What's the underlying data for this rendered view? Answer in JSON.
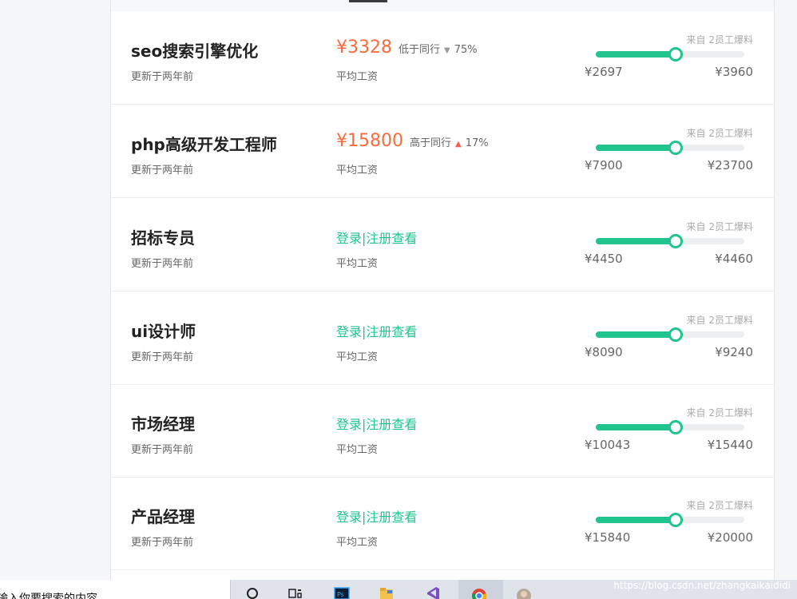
{
  "jobs": [
    {
      "title": "seo搜索引擎优化",
      "updated": "更新于两年前",
      "salary": "¥3328",
      "compare": "低于同行",
      "direction": "down",
      "percent": "75%",
      "login_text": "",
      "salary_label": "平均工资",
      "source": "来自 2员工爆料",
      "range_min": "¥2697",
      "range_max": "¥3960",
      "bar_fraction": 0.53
    },
    {
      "title": "php高级开发工程师",
      "updated": "更新于两年前",
      "salary": "¥15800",
      "compare": "高于同行",
      "direction": "up",
      "percent": "17%",
      "login_text": "",
      "salary_label": "平均工资",
      "source": "来自 2员工爆料",
      "range_min": "¥7900",
      "range_max": "¥23700",
      "bar_fraction": 0.53
    },
    {
      "title": "招标专员",
      "updated": "更新于两年前",
      "salary": "",
      "compare": "",
      "direction": "",
      "percent": "",
      "login_text": "登录|注册查看",
      "salary_label": "平均工资",
      "source": "来自 2员工爆料",
      "range_min": "¥4450",
      "range_max": "¥4460",
      "bar_fraction": 0.53
    },
    {
      "title": "ui设计师",
      "updated": "更新于两年前",
      "salary": "",
      "compare": "",
      "direction": "",
      "percent": "",
      "login_text": "登录|注册查看",
      "salary_label": "平均工资",
      "source": "来自 2员工爆料",
      "range_min": "¥8090",
      "range_max": "¥9240",
      "bar_fraction": 0.53
    },
    {
      "title": "市场经理",
      "updated": "更新于两年前",
      "salary": "",
      "compare": "",
      "direction": "",
      "percent": "",
      "login_text": "登录|注册查看",
      "salary_label": "平均工资",
      "source": "来自 2员工爆料",
      "range_min": "¥10043",
      "range_max": "¥15440",
      "bar_fraction": 0.53
    },
    {
      "title": "产品经理",
      "updated": "更新于两年前",
      "salary": "",
      "compare": "",
      "direction": "",
      "percent": "",
      "login_text": "登录|注册查看",
      "salary_label": "平均工资",
      "source": "来自 2员工爆料",
      "range_min": "¥15840",
      "range_max": "¥20000",
      "bar_fraction": 0.53
    }
  ],
  "taskbar": {
    "search_placeholder": "输入你要搜索的内容",
    "icons": [
      "search-icon",
      "task-view-icon",
      "photoshop-icon",
      "file-explorer-icon",
      "visual-studio-icon",
      "chrome-icon",
      "user-avatar-icon"
    ]
  },
  "watermark": "https://blog.csdn.net/zhangkaikaididi",
  "colors": {
    "salary": "#fc6b3c",
    "accent": "#21c48c",
    "up_arrow": "#ff5a4e",
    "down_arrow": "#999999"
  }
}
